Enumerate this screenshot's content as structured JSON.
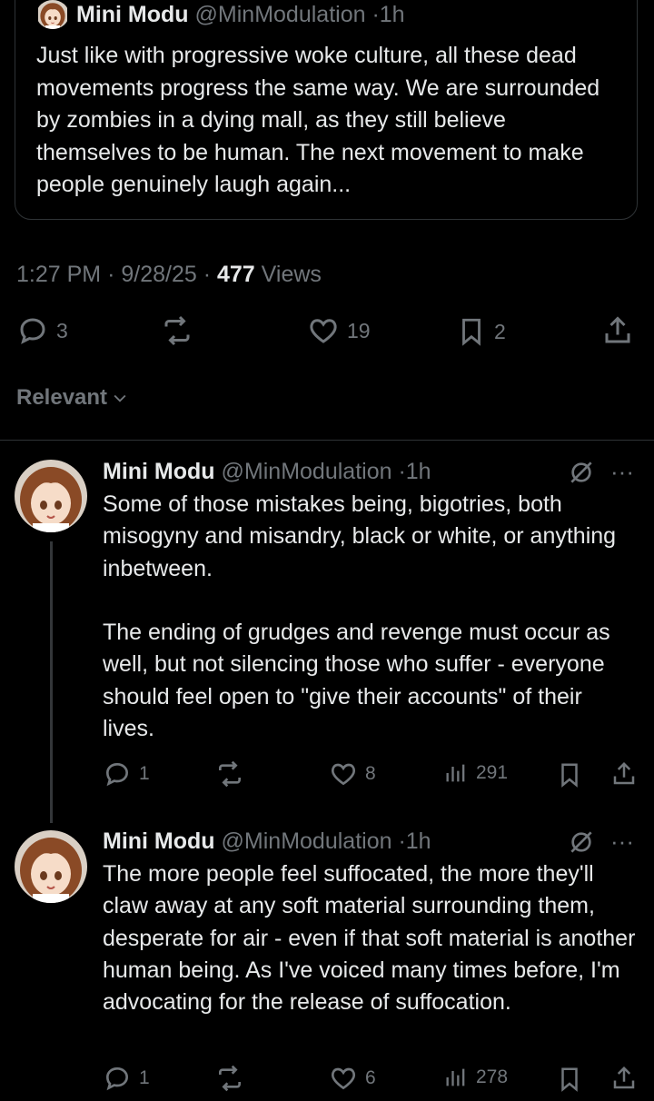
{
  "quoted": {
    "name": "Mini Modu",
    "handle": "@MinModulation",
    "time": "1h",
    "text": "Just like with progressive woke culture, all these dead movements progress the same way. We are surrounded by zombies in a dying mall, as they still believe themselves to be human. The next movement to make people genuinely laugh again..."
  },
  "meta": {
    "time": "1:27 PM",
    "date": "9/28/25",
    "views_count": "477",
    "views_label": "Views"
  },
  "actions": {
    "replies": "3",
    "likes": "19",
    "bookmarks": "2"
  },
  "sort": {
    "label": "Relevant"
  },
  "replies": [
    {
      "name": "Mini Modu",
      "handle": "@MinModulation",
      "time": "1h",
      "text": "Some of those mistakes being, bigotries, both misogyny and misandry, black or white, or anything inbetween.\n\nThe ending of grudges and revenge must occur as well, but not silencing those who suffer - everyone should feel open to \"give their accounts\" of their lives.",
      "replies": "1",
      "likes": "8",
      "views": "291"
    },
    {
      "name": "Mini Modu",
      "handle": "@MinModulation",
      "time": "1h",
      "text": "The more people feel suffocated, the more they'll claw away at any soft material surrounding them, desperate for air - even if that soft material is another human being. As I've voiced many times before, I'm advocating for the release of suffocation.",
      "replies": "1",
      "likes": "6",
      "views": "278"
    }
  ],
  "colors": {
    "background": "#000000",
    "text": "#e7e9ea",
    "muted": "#71767b",
    "border": "#2f3336"
  }
}
